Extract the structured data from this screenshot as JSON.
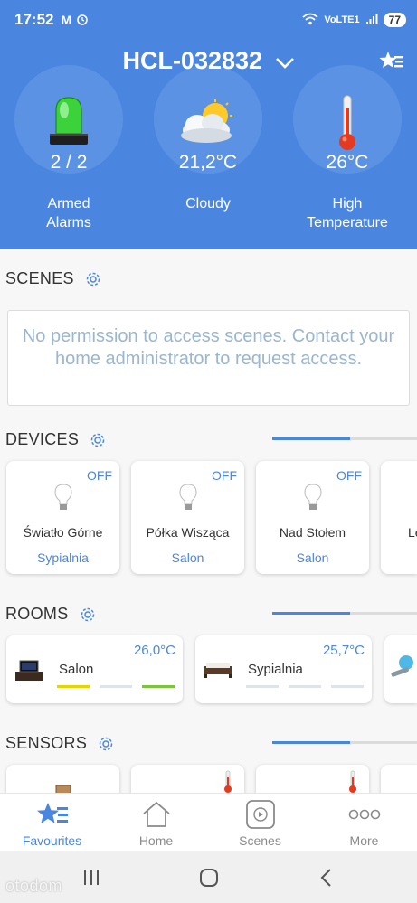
{
  "status": {
    "time": "17:52",
    "indicators": [
      "M",
      "alarm-clock-icon"
    ],
    "network_text": "VoLTE1",
    "battery": "77"
  },
  "header": {
    "title": "HCL-032832",
    "widgets": [
      {
        "value": "2 / 2",
        "label_line1": "Armed",
        "label_line2": "Alarms",
        "icon": "siren-icon"
      },
      {
        "value": "21,2°C",
        "label_line1": "Cloudy",
        "label_line2": "",
        "icon": "cloud-sun-icon"
      },
      {
        "value": "26°C",
        "label_line1": "High",
        "label_line2": "Temperature",
        "icon": "thermometer-icon"
      }
    ]
  },
  "scenes": {
    "title": "SCENES",
    "message": "No permission to access scenes. Contact your home administrator to request access."
  },
  "devices": {
    "title": "DEVICES",
    "items": [
      {
        "state": "OFF",
        "name": "Światło Górne",
        "room": "Sypialnia"
      },
      {
        "state": "OFF",
        "name": "Półka Wisząca",
        "room": "Salon"
      },
      {
        "state": "OFF",
        "name": "Nad Stołem",
        "room": "Salon"
      },
      {
        "state": "",
        "name": "Le",
        "room": ""
      }
    ]
  },
  "rooms": {
    "title": "ROOMS",
    "items": [
      {
        "name": "Salon",
        "temp": "26,0°C"
      },
      {
        "name": "Sypialnia",
        "temp": "25,7°C"
      }
    ]
  },
  "sensors": {
    "title": "SENSORS"
  },
  "bottom_nav": [
    {
      "label": "Favourites",
      "icon": "star-list-icon",
      "active": true
    },
    {
      "label": "Home",
      "icon": "house-icon",
      "active": false
    },
    {
      "label": "Scenes",
      "icon": "play-icon",
      "active": false
    },
    {
      "label": "More",
      "icon": "more-dots-icon",
      "active": false
    }
  ],
  "watermark": "otodom",
  "colors": {
    "accent": "#4a86e0",
    "header_bg": "#4a86e0",
    "indicator_yellow": "#e6d600",
    "indicator_green": "#7cc43a",
    "indicator_gray": "#dfe4ea"
  }
}
